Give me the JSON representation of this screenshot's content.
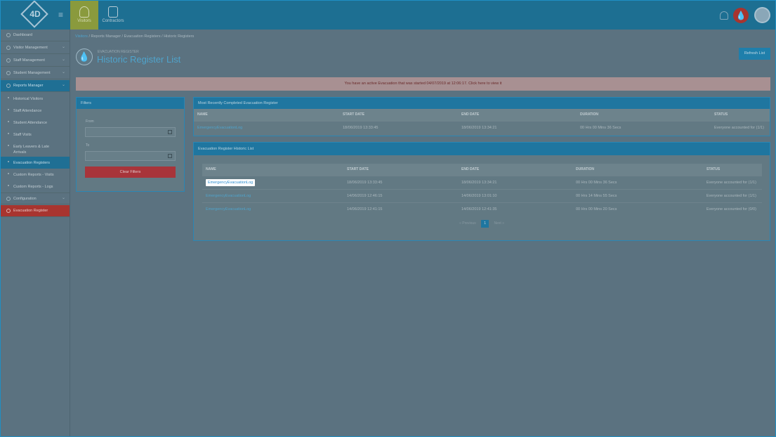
{
  "topbar": {
    "logo": "4D",
    "modules": [
      {
        "label": "Visitors",
        "active": true
      },
      {
        "label": "Contractors",
        "active": false
      }
    ]
  },
  "sidebar": {
    "items": [
      {
        "label": "Dashboard",
        "icon": "dashboard-icon"
      },
      {
        "label": "Visitor Management",
        "icon": "person-icon"
      },
      {
        "label": "Staff Management",
        "icon": "staff-icon"
      },
      {
        "label": "Student Management",
        "icon": "student-icon"
      },
      {
        "label": "Reports Manager",
        "icon": "reports-icon"
      }
    ],
    "reports_sub": [
      "Historical Visitors",
      "Staff Attendance",
      "Student Attendance",
      "Staff Visits",
      "Early Leavers & Late Arrivals",
      "Evacuation Registers",
      "Custom Reports - Visits",
      "Custom Reports - Logs"
    ],
    "configuration": "Configuration",
    "evacuation_register": "Evacuation Register"
  },
  "breadcrumb": [
    "Visitors",
    "Reports Manager",
    "Evacuation Registers",
    "Historic Registers"
  ],
  "page": {
    "subtitle": "EVACUATION REGISTER",
    "title": "Historic Register List",
    "refresh_label": "Refresh List"
  },
  "alert": "You have an active Evacuation that was started 04/07/2019 at 12:06:17. Click here to view it",
  "filters": {
    "title": "Filters",
    "from_label": "From",
    "to_label": "To",
    "clear_label": "Clear Filters"
  },
  "recent": {
    "title": "Most Recently Completed Evacuation Register",
    "columns": [
      "NAME",
      "START DATE",
      "END DATE",
      "DURATION",
      "STATUS"
    ],
    "row": [
      "EmergencyEvacuationLog",
      "18/06/2019 13:33:45",
      "18/06/2019 13:34:21",
      "00 Hrs 00 Mins 36 Secs",
      "Everyone accounted for (1/1)"
    ]
  },
  "historic": {
    "title": "Evacuation Register Historic List",
    "columns": [
      "NAME",
      "START DATE",
      "END DATE",
      "DURATION",
      "STATUS"
    ],
    "rows": [
      [
        "EmergencyEvacuationLog",
        "18/06/2019 13:33:45",
        "18/06/2019 13:34:21",
        "00 Hrs 00 Mins 36 Secs",
        "Everyone accounted for (1/1)"
      ],
      [
        "EmergencyEvacuationLog",
        "14/06/2019 12:46:15",
        "14/06/2019 13:01:10",
        "00 Hrs 14 Mins 55 Secs",
        "Everyone accounted for (1/1)"
      ],
      [
        "EmergencyEvacuationLog",
        "14/06/2019 12:41:15",
        "14/06/2019 12:41:35",
        "00 Hrs 00 Mins 20 Secs",
        "Everyone accounted for (0/0)"
      ]
    ],
    "pager": {
      "previous": "Previous",
      "page": "1",
      "next": "Next"
    }
  }
}
